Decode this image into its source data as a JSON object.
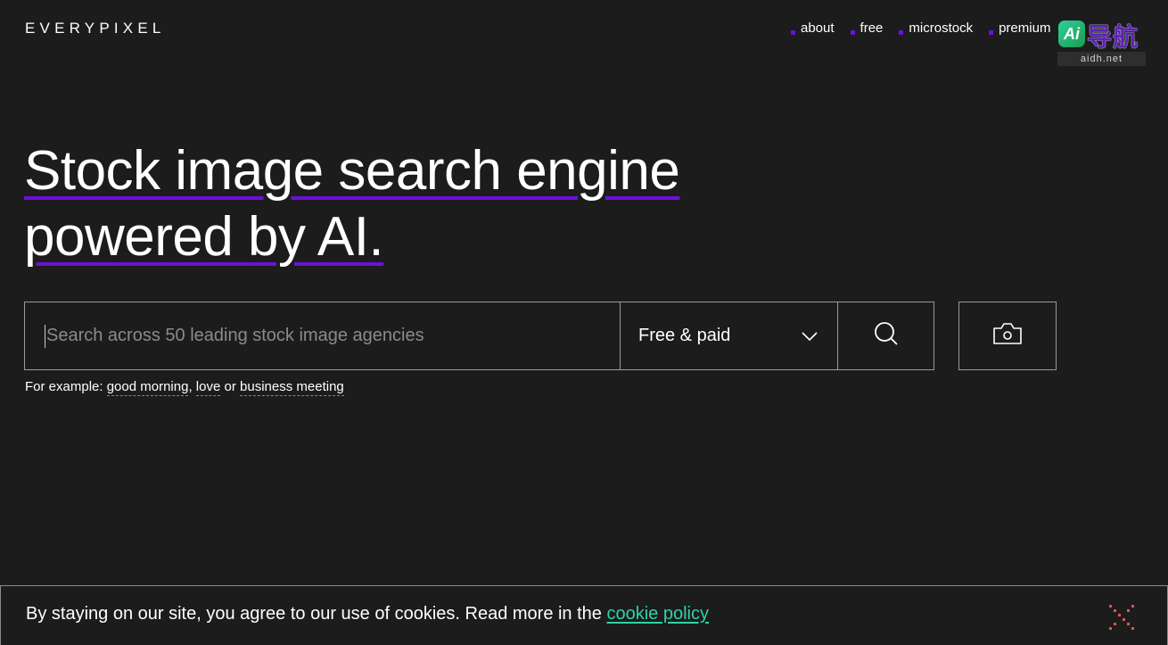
{
  "header": {
    "logo": "EVERYPIXEL",
    "nav": [
      {
        "label": "about"
      },
      {
        "label": "free"
      },
      {
        "label": "microstock"
      },
      {
        "label": "premium"
      }
    ]
  },
  "watermark": {
    "ai_label": "Ai",
    "cn_text": "导航",
    "domain": "aidh.net"
  },
  "hero": {
    "line1": "Stock image search engine",
    "line2": "powered by AI."
  },
  "search": {
    "placeholder": "Search across 50 leading stock image agencies",
    "value": "",
    "filter_selected": "Free & paid"
  },
  "examples": {
    "prefix": "For example:",
    "items": [
      "good morning",
      "love",
      "business meeting"
    ],
    "sep1": ",",
    "sep2": "or"
  },
  "cookie": {
    "text": "By staying on our site, you agree to our use of cookies. Read more in the",
    "link": "cookie policy"
  },
  "colors": {
    "accent_purple": "#6a11d8",
    "accent_green": "#2fd3a4",
    "background": "#1c1c1c"
  }
}
